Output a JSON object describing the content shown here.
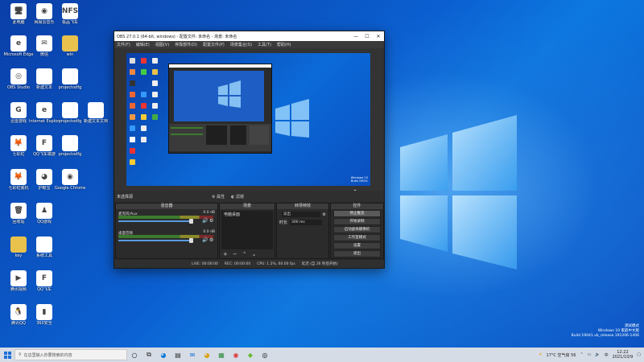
{
  "desktop": {
    "icons": [
      {
        "label": "此电脑",
        "glyph": "🖥",
        "style": "file"
      },
      {
        "label": "网易云音乐",
        "glyph": "◉",
        "style": "file"
      },
      {
        "label": "极品飞车",
        "glyph": "NFS",
        "style": "file"
      },
      {
        "label": "Microsoft Edge",
        "glyph": "e",
        "style": "file"
      },
      {
        "label": "微信",
        "glyph": "✉",
        "style": "file"
      },
      {
        "label": "win",
        "glyph": "",
        "style": "folder"
      },
      {
        "label": "OBS Studio",
        "glyph": "◎",
        "style": "file"
      },
      {
        "label": "新建文本",
        "glyph": "",
        "style": "file"
      },
      {
        "label": "projectodfg",
        "glyph": "",
        "style": "file"
      },
      {
        "label": "迅雷游戏",
        "glyph": "G",
        "style": "file"
      },
      {
        "label": "Internet Explorer",
        "glyph": "e",
        "style": "file"
      },
      {
        "label": "projectodfg",
        "glyph": "",
        "style": "file"
      },
      {
        "label": "新建文本文档",
        "glyph": "",
        "style": "file"
      },
      {
        "label": "七彩虹",
        "glyph": "🦊",
        "style": "file"
      },
      {
        "label": "QQ飞车端游",
        "glyph": "F",
        "style": "file"
      },
      {
        "label": "projectodfg",
        "glyph": "",
        "style": "file"
      },
      {
        "label": "七彩虹装机",
        "glyph": "🦊",
        "style": "file"
      },
      {
        "label": "护眼宝",
        "glyph": "◕",
        "style": "file"
      },
      {
        "label": "Google Chrome",
        "glyph": "◉",
        "style": "file"
      },
      {
        "label": "回收站",
        "glyph": "🗑",
        "style": "file"
      },
      {
        "label": "QQ游戏",
        "glyph": "♟",
        "style": "file"
      },
      {
        "label": "key",
        "glyph": "",
        "style": "folder"
      },
      {
        "label": "系统工具",
        "glyph": "",
        "style": "file"
      },
      {
        "label": "腾讯视频",
        "glyph": "▶",
        "style": "file"
      },
      {
        "label": "QQ飞车",
        "glyph": "F",
        "style": "file"
      },
      {
        "label": "腾讯QQ",
        "glyph": "🐧",
        "style": "file"
      },
      {
        "label": "360安全",
        "glyph": "▮",
        "style": "file"
      }
    ]
  },
  "obs": {
    "title": "OBS 27.0.1 (64-bit, windows) - 配置文件: 未命名 - 场景: 未命名",
    "menu": [
      "文件(F)",
      "编辑(E)",
      "视图(V)",
      "停靠部件(D)",
      "配置文件(P)",
      "场景集合(S)",
      "工具(T)",
      "帮助(H)"
    ],
    "source_bar": {
      "no_source": "未选择源",
      "props": "属性",
      "filters": "滤镜"
    },
    "mixer": {
      "header": "混音器",
      "channels": [
        {
          "name": "麦克风/Aux",
          "db": "0.0 dB"
        },
        {
          "name": "桌面音频",
          "db": "0.0 dB"
        }
      ]
    },
    "scenes": {
      "header": "场景",
      "items": [
        "电脑桌面"
      ]
    },
    "transitions": {
      "header": "转场特效",
      "type": "淡出",
      "duration_label": "时长",
      "duration_value": "300 ms"
    },
    "controls": {
      "header": "控件",
      "buttons": [
        "停止推流",
        "开始录制",
        "启动虚拟摄像机",
        "工作室模式",
        "设置",
        "退出"
      ]
    },
    "status": {
      "live": "LIVE: 00:00:00",
      "rec": "REC: 00:00:00",
      "cpu": "CPU: 1.2%, 60.00 fps",
      "delay": "延迟 (自 26 秒后开始)"
    }
  },
  "watermark": {
    "line1": "测试模式",
    "line2": "Windows 10 家庭中文版",
    "line3": "Build 19041.vb_release.191206-1406"
  },
  "taskbar": {
    "search_placeholder": "在这里输入你要搜索的内容",
    "weather": "17°C 空气良 56",
    "time": "12:22",
    "date": "2021/10/9"
  }
}
